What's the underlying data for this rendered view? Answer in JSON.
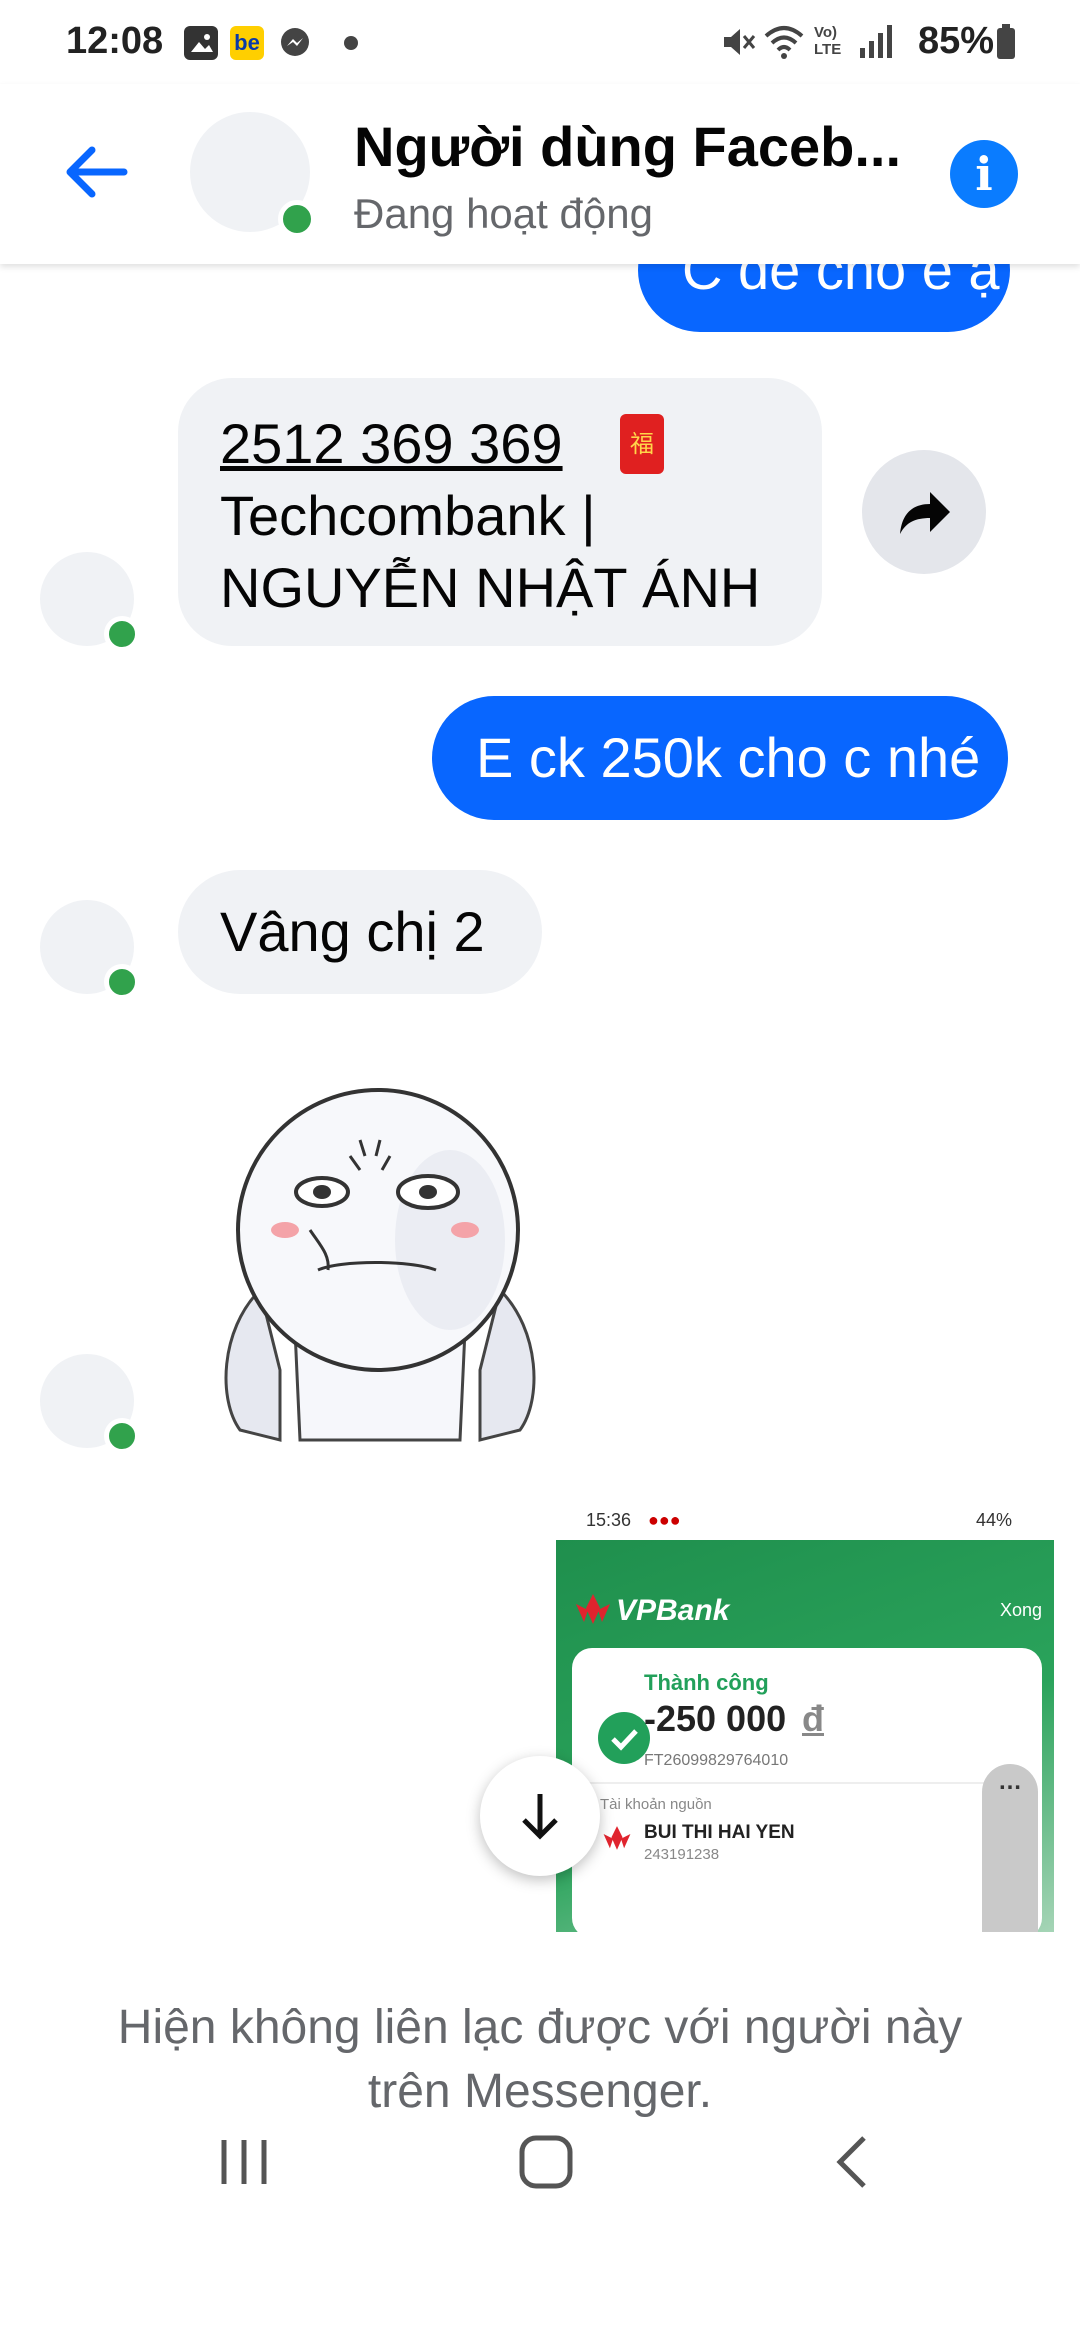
{
  "status_bar": {
    "time": "12:08",
    "battery": "85%",
    "app_badge": "be"
  },
  "header": {
    "title": "Người dùng Faceb...",
    "subtitle": "Đang hoạt động",
    "info_glyph": "i"
  },
  "messages": {
    "top_partial": "C để cho e ạ",
    "bank_number": "2512 369 369",
    "bank_line2": "Techcombank |",
    "bank_line3": "NGUYỄN NHẬT ÁNH",
    "envelope_char": "福",
    "out_transfer": "E ck 250k cho c nhé",
    "in_reply": "Vâng chị 2"
  },
  "screenshot": {
    "time": "15:36",
    "battery": "44%",
    "bank": "VPBank",
    "done": "Xong",
    "status": "Thành công",
    "amount": "-250 000",
    "currency": "đ",
    "txn_id": "FT26099829764010",
    "source_label": "Tài khoản nguồn",
    "account_name": "BUI THI HAI YEN",
    "account_num": "243191238"
  },
  "footer": {
    "notice_line1": "Hiện không liên lạc được với người này",
    "notice_line2": "trên Messenger."
  },
  "colors": {
    "accent": "#0866ff",
    "online": "#31a24c",
    "bank_green": "#1f8f4d"
  }
}
